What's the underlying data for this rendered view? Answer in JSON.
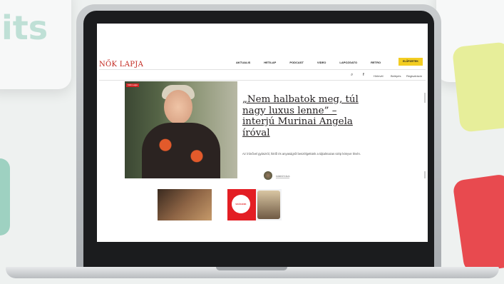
{
  "background": {
    "text": "its",
    "colors": {
      "page": "#eef1f0",
      "mint": "#bfe0d6",
      "lime": "#e7ee9a",
      "red": "#e84a4f",
      "teal": "#9ed1c1"
    }
  },
  "browser_page": {
    "logo": "NŐK LAPJA",
    "nav": [
      "AKTUALIS",
      "HETILAP",
      "PODCAST",
      "VIDEO",
      "LAPOZGATO",
      "RETRO"
    ],
    "subscribe_label": "ELŐFIZETEK",
    "utility": {
      "search_icon": "search-icon",
      "facebook_icon": "facebook-icon",
      "links": [
        "Hírlevél",
        "Belépés",
        "Regisztráció"
      ]
    },
    "hero": {
      "badge": "Nők Lapja",
      "title": "„Nem halbatok meg, túl nagy luxus lenne” – interjú Murinai Angela íróval",
      "lead": "Az írónővel gyászról, hitről és anyaságról beszélgettünk a tájtalmazas szép könyve lévén.",
      "author": "KÁRPÁTI ÉVA",
      "colors": {
        "accent": "#c2261d",
        "title": "#231f20"
      }
    },
    "thumbnails": [
      {
        "name": "thumb-photo-1"
      },
      {
        "name": "thumb-photo-2",
        "label": "SZÁZADIK SZÜLETÉSNAPJA"
      }
    ]
  }
}
